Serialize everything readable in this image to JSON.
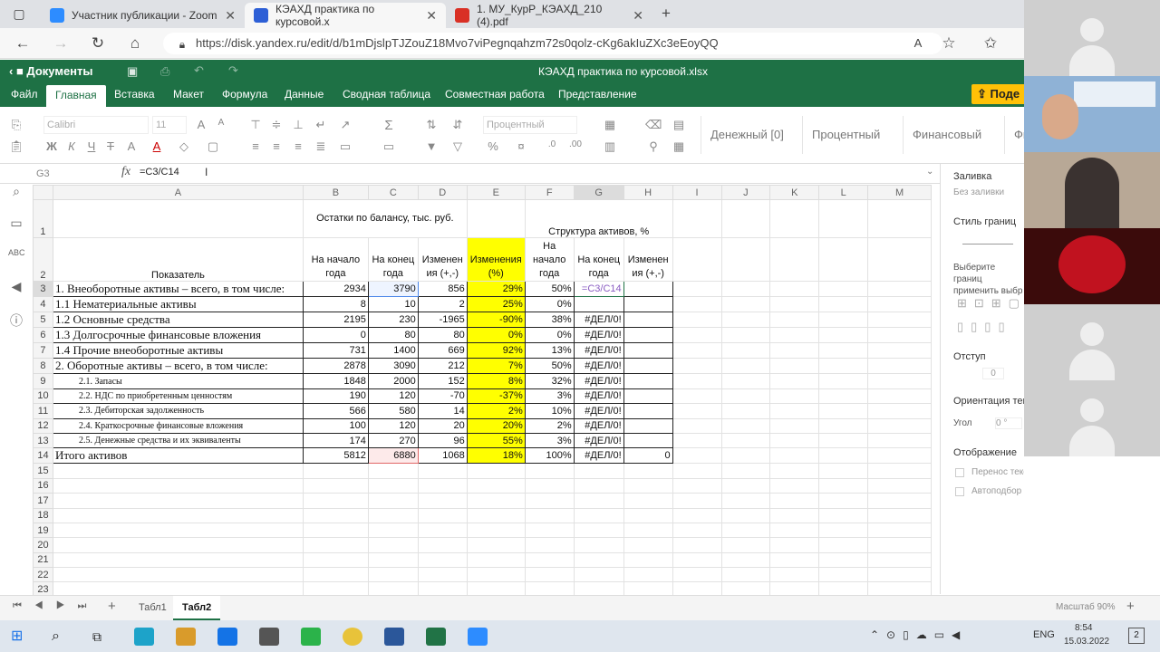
{
  "browser": {
    "tabs": [
      {
        "label": "Участник публикации - Zoom",
        "color": "#2d8cff"
      },
      {
        "label": "КЭАХД практика по курсовой.x",
        "color": "#2d5fd6"
      },
      {
        "label": "1. МУ_КурР_КЭАХД_210 (4).pdf",
        "color": "#d93025"
      }
    ],
    "url": "https://disk.yandex.ru/edit/d/b1mDjslpTJZouZ18Mvo7viPegnqahzm72s0qolz-cKg6akIuZXc3eEoyQQ"
  },
  "app": {
    "back_label": "Документы",
    "file_title": "КЭАХД практика по курсовой.xlsx",
    "menu": [
      "Файл",
      "Главная",
      "Вставка",
      "Макет",
      "Формула",
      "Данные",
      "Сводная таблица",
      "Совместная работа",
      "Представление"
    ],
    "active_menu": "Главная",
    "share_label": "Поде",
    "accent": "#1e7145"
  },
  "ribbon": {
    "font_name": "Calibri",
    "font_size": "11",
    "number_format": "Процентный",
    "styles": [
      "Денежный [0]",
      "Процентный",
      "Финансовый",
      "Фи"
    ]
  },
  "formula_bar": {
    "name_box": "G3",
    "fx": "fx",
    "formula": "=C3/C14"
  },
  "grid": {
    "columns": [
      "A",
      "B",
      "C",
      "D",
      "E",
      "F",
      "G",
      "H",
      "I",
      "J",
      "K",
      "L",
      "M"
    ],
    "header_row1": {
      "bcd": "Остатки по балансу, тыс. руб.",
      "fgh": "Структура активов, %"
    },
    "header_row2": {
      "a": "Показатель",
      "b": "На начало года",
      "c": "На конец года",
      "d": "Изменен ия (+,-)",
      "e": "Изменения (%)",
      "f": "На начало года",
      "g": "На конец года",
      "h": "Изменен ия (+,-)"
    },
    "rows": [
      {
        "n": "3",
        "a": "1. Внеоборотные активы – всего, в том числе:",
        "b": "2934",
        "c": "3790",
        "d": "856",
        "e": "29%",
        "f": "50%",
        "g": "=C3/C14",
        "h": ""
      },
      {
        "n": "4",
        "a": "1.1 Нематериальные активы",
        "b": "8",
        "c": "10",
        "d": "2",
        "e": "25%",
        "f": "0%",
        "g": "",
        "h": ""
      },
      {
        "n": "5",
        "a": "1.2 Основные средства",
        "b": "2195",
        "c": "230",
        "d": "-1965",
        "e": "-90%",
        "f": "38%",
        "g": "#ДЕЛ/0!",
        "h": ""
      },
      {
        "n": "6",
        "a": "1.3 Долгосрочные финансовые вложения",
        "b": "0",
        "c": "80",
        "d": "80",
        "e": "0%",
        "f": "0%",
        "g": "#ДЕЛ/0!",
        "h": ""
      },
      {
        "n": "7",
        "a": "1.4 Прочие внеоборотные активы",
        "b": "731",
        "c": "1400",
        "d": "669",
        "e": "92%",
        "f": "13%",
        "g": "#ДЕЛ/0!",
        "h": ""
      },
      {
        "n": "8",
        "a": "2. Оборотные активы – всего, в том числе:",
        "b": "2878",
        "c": "3090",
        "d": "212",
        "e": "7%",
        "f": "50%",
        "g": "#ДЕЛ/0!",
        "h": ""
      },
      {
        "n": "9",
        "a": "2.1. Запасы",
        "b": "1848",
        "c": "2000",
        "d": "152",
        "e": "8%",
        "f": "32%",
        "g": "#ДЕЛ/0!",
        "h": ""
      },
      {
        "n": "10",
        "a": "2.2. НДС по приобретенным ценностям",
        "b": "190",
        "c": "120",
        "d": "-70",
        "e": "-37%",
        "f": "3%",
        "g": "#ДЕЛ/0!",
        "h": ""
      },
      {
        "n": "11",
        "a": "2.3. Дебиторская задолженность",
        "b": "566",
        "c": "580",
        "d": "14",
        "e": "2%",
        "f": "10%",
        "g": "#ДЕЛ/0!",
        "h": ""
      },
      {
        "n": "12",
        "a": "2.4. Краткосрочные финансовые вложения",
        "b": "100",
        "c": "120",
        "d": "20",
        "e": "20%",
        "f": "2%",
        "g": "#ДЕЛ/0!",
        "h": ""
      },
      {
        "n": "13",
        "a": "2.5. Денежные средства и их эквиваленты",
        "b": "174",
        "c": "270",
        "d": "96",
        "e": "55%",
        "f": "3%",
        "g": "#ДЕЛ/0!",
        "h": ""
      },
      {
        "n": "14",
        "a": "Итого активов",
        "b": "5812",
        "c": "6880",
        "d": "1068",
        "e": "18%",
        "f": "100%",
        "g": "#ДЕЛ/0!",
        "h": "0"
      }
    ],
    "empty_rows": [
      "15",
      "16",
      "17",
      "18",
      "19",
      "20",
      "21",
      "22",
      "23"
    ],
    "highlight_color": "#ffff00"
  },
  "right_panel": {
    "fill_title": "Заливка",
    "fill_value": "Без заливки",
    "border_style_title": "Стиль границ",
    "border_hint": "Выберите границ применить выбр",
    "indent_title": "Отступ",
    "indent_value": "0",
    "orientation_title": "Ориентация тек",
    "angle_label": "Угол",
    "angle_value": "0 °",
    "display_title": "Отображение",
    "wrap_label": "Перенос текста",
    "autofit_label": "Автоподбор ширины"
  },
  "sheets": {
    "tabs": [
      "Табл1",
      "Табл2"
    ],
    "active": "Табл2",
    "zoom_label": "Масштаб 90%"
  },
  "taskbar": {
    "lang": "ENG",
    "time": "8:54",
    "date": "15.03.2022",
    "notifications": "2"
  }
}
